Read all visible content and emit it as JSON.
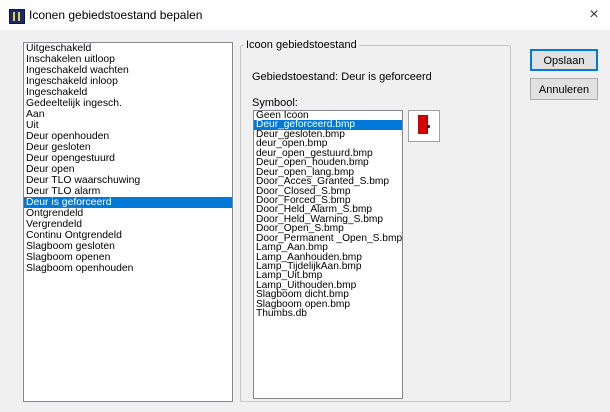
{
  "window": {
    "title": "Iconen gebiedstoestand bepalen",
    "close_glyph": "×",
    "icon": "app-icon"
  },
  "states": {
    "items": [
      "Uitgeschakeld",
      "Inschakelen uitloop",
      "Ingeschakeld wachten",
      "Ingeschakeld inloop",
      "Ingeschakeld",
      "Gedeeltelijk ingesch.",
      "Aan",
      "Uit",
      "Deur openhouden",
      "Deur gesloten",
      "Deur opengestuurd",
      "Deur open",
      "Deur TLO waarschuwing",
      "Deur TLO alarm",
      "Deur is geforceerd",
      "Ontgrendeld",
      "Vergrendeld",
      "Continu Ontgrendeld",
      "Slagboom gesloten",
      "Slagboom openen",
      "Slagboom openhouden"
    ],
    "selected": "Deur is geforceerd"
  },
  "group": {
    "legend": "Icoon gebiedstoestand",
    "status_text": "Gebiedstoestand: Deur is geforceerd",
    "symbol_label": "Symbool:"
  },
  "symbols": {
    "items": [
      "Geen Icoon",
      "Deur_geforceerd.bmp",
      "Deur_gesloten.bmp",
      "deur_open.bmp",
      "deur_open_gestuurd.bmp",
      "Deur_open_houden.bmp",
      "Deur_open_lang.bmp",
      "Door_Acces_Granted_S.bmp",
      "Door_Closed_S.bmp",
      "Door_Forced_S.bmp",
      "Door_Held_Alarm_S.bmp",
      "Door_Held_Warning_S.bmp",
      "Door_Open_S.bmp",
      "Door_Permanent _Open_S.bmp",
      "Lamp_Aan.bmp",
      "Lamp_Aanhouden.bmp",
      "Lamp_TijdelijkAan.bmp",
      "Lamp_Uit.bmp",
      "Lamp_Uithouden.bmp",
      "Slagboom dicht.bmp",
      "Slagboom open.bmp",
      "Thumbs.db"
    ],
    "selected": "Deur_geforceerd.bmp",
    "preview_icon": "door-forced-icon"
  },
  "buttons": {
    "save_label": "Opslaan",
    "cancel_label": "Annuleren"
  },
  "colors": {
    "selection": "#0078d7",
    "door_red": "#d80000"
  }
}
